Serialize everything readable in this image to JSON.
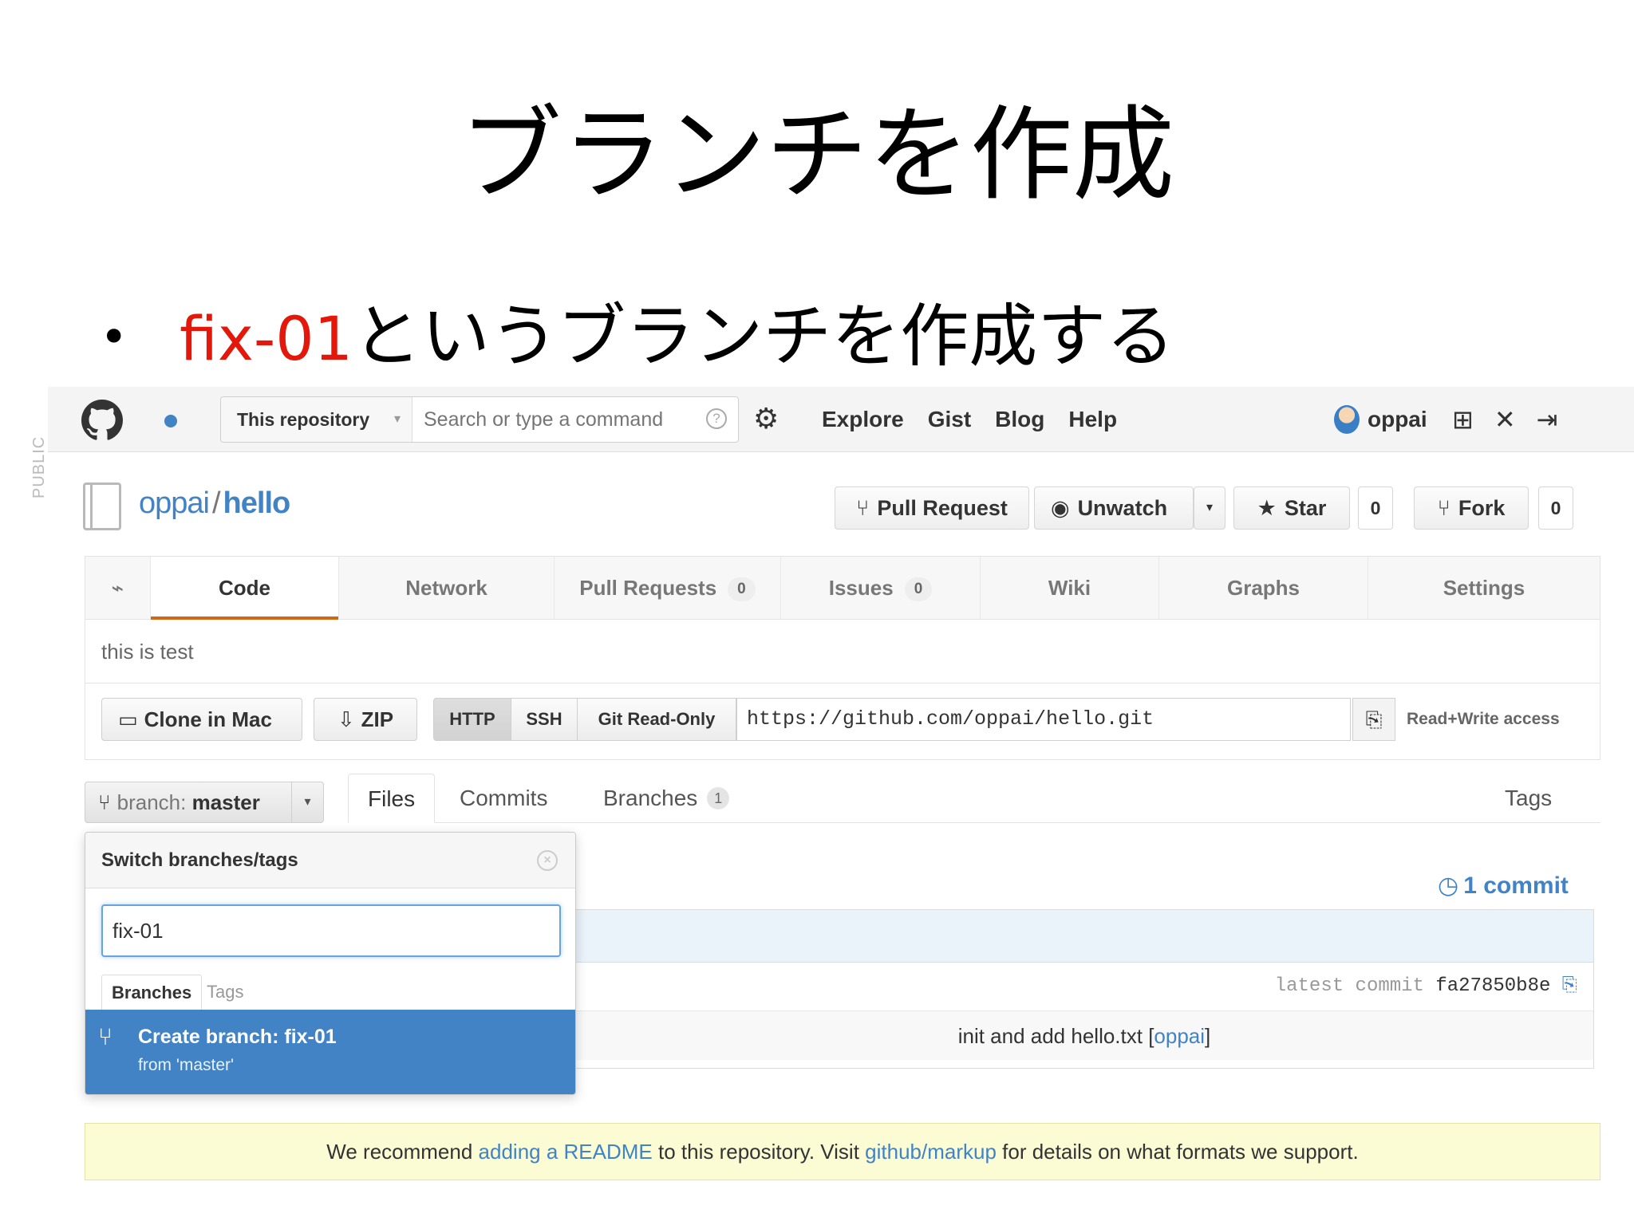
{
  "slide": {
    "title": "ブランチを作成",
    "bullet_marker": "•",
    "bullet_highlight": "fix-01",
    "bullet_rest": "というブランチを作成する",
    "highlight_color": "#e3170a"
  },
  "topbar": {
    "search_scope": "This repository",
    "search_placeholder": "Search or type a command",
    "nav": [
      "Explore",
      "Gist",
      "Blog",
      "Help"
    ],
    "username": "oppai"
  },
  "repo": {
    "visibility": "PUBLIC",
    "owner": "oppai",
    "separator": "/",
    "name": "hello",
    "buttons": {
      "pull_request": "Pull Request",
      "unwatch": "Unwatch",
      "star": "Star",
      "star_count": "0",
      "fork": "Fork",
      "fork_count": "0"
    },
    "tabs": [
      {
        "label": "Code"
      },
      {
        "label": "Network"
      },
      {
        "label": "Pull Requests",
        "count": "0"
      },
      {
        "label": "Issues",
        "count": "0"
      },
      {
        "label": "Wiki"
      },
      {
        "label": "Graphs"
      },
      {
        "label": "Settings"
      }
    ],
    "description": "this is test"
  },
  "clone": {
    "clone_in_mac": "Clone in Mac",
    "zip": "ZIP",
    "protocols": [
      "HTTP",
      "SSH",
      "Git Read-Only"
    ],
    "url": "https://github.com/oppai/hello.git",
    "access": "Read+Write access"
  },
  "branchbar": {
    "label": "branch:",
    "branch": "master",
    "tabs": {
      "files": "Files",
      "commits": "Commits",
      "branches": "Branches",
      "branches_count": "1",
      "tags": "Tags"
    },
    "commit_count": "1 commit"
  },
  "filebox": {
    "latest_label": "latest commit",
    "latest_hash": "fa27850b8e",
    "message": "init and add hello.txt [",
    "author": "oppai",
    "message_end": "]"
  },
  "dropdown": {
    "title": "Switch branches/tags",
    "input_value": "fix-01",
    "tab_branches": "Branches",
    "tab_tags": "Tags",
    "create_label": "Create branch: fix-01",
    "create_from": "from 'master'"
  },
  "notice": {
    "t1": "We recommend ",
    "link1": "adding a README",
    "t2": " to this repository. Visit ",
    "link2": "github/markup",
    "t3": " for details on what formats we support."
  },
  "colors": {
    "link": "#4183c4",
    "active_tab_underline": "#d26911",
    "notice_bg": "#fbfbd4"
  }
}
